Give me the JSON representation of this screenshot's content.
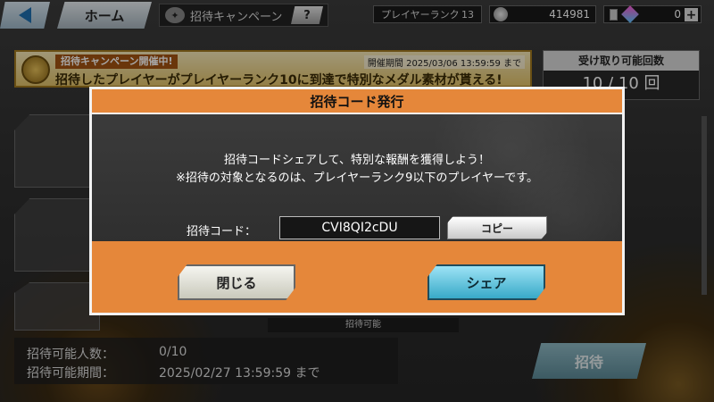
{
  "topbar": {
    "home_label": "ホーム",
    "campaign_tab_label": "招待キャンペーン",
    "help_label": "?",
    "rank_label": "プレイヤーランク",
    "rank_value": "13",
    "coins": "414981",
    "gems": "0",
    "plus_label": "+"
  },
  "banner": {
    "tag": "招待キャンペーン開催中!",
    "period": "開催期間 2025/03/06 13:59:59 まで",
    "headline": "招待したプレイヤーがプレイヤーランク10に到達で特別なメダル素材が貰える!"
  },
  "receive": {
    "header": "受け取り可能回数",
    "value": "10 / 10 回"
  },
  "status": {
    "invitable_label": "招待可能",
    "count_label": "招待可能人数：",
    "count_value": "0/10",
    "period_label": "招待可能期間：",
    "period_value": "2025/02/27 13:59:59 まで",
    "invite_button": "招待"
  },
  "modal": {
    "title": "招待コード発行",
    "line1": "招待コードシェアして、特別な報酬を獲得しよう！",
    "line2": "※招待の対象となるのは、プレイヤーランク9以下のプレイヤーです。",
    "code_label": "招待コード：",
    "code_value": "CVI8QI2cDU",
    "copy_label": "コピー",
    "close_label": "閉じる",
    "share_label": "シェア"
  }
}
